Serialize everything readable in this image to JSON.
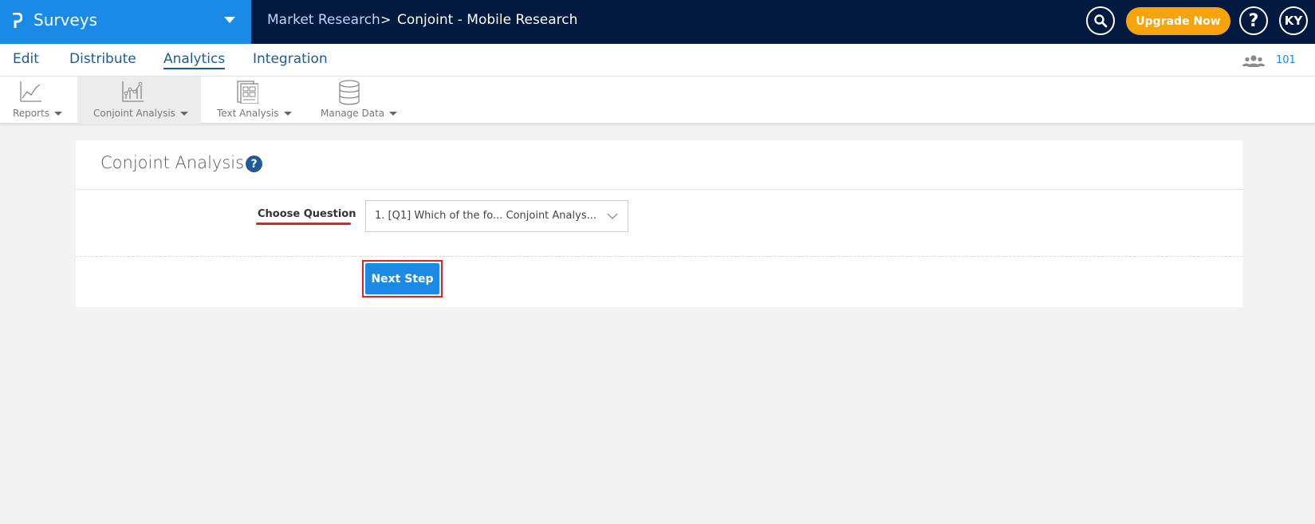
{
  "brand": {
    "title": "Surveys",
    "color": "#1a8ae6"
  },
  "breadcrumb": {
    "parent": "Market Research",
    "separator": ">",
    "current": "Conjoint - Mobile Research"
  },
  "header": {
    "upgrade_label": "Upgrade Now",
    "help_label": "?",
    "avatar_initials": "KY",
    "upgrade_color": "#f7a30c",
    "bg_color": "#021a3f"
  },
  "tabs": [
    {
      "label": "Edit"
    },
    {
      "label": "Distribute"
    },
    {
      "label": "Analytics",
      "active": true
    },
    {
      "label": "Integration"
    }
  ],
  "collaborators": {
    "count": "101",
    "icon": "users-icon"
  },
  "toolbar": [
    {
      "label": "Reports",
      "icon": "line-chart-icon"
    },
    {
      "label": "Conjoint Analysis",
      "icon": "scatter-chart-icon",
      "active": true
    },
    {
      "label": "Text Analysis",
      "icon": "document-grid-icon"
    },
    {
      "label": "Manage Data",
      "icon": "database-icon"
    }
  ],
  "card": {
    "title": "Conjoint Analysis",
    "help_icon": "?",
    "question_label": "Choose Question",
    "question_value": "1. [Q1] Which of the fo... Conjoint Analys...",
    "next_label": "Next Step",
    "highlight_color": "#e0202a"
  }
}
